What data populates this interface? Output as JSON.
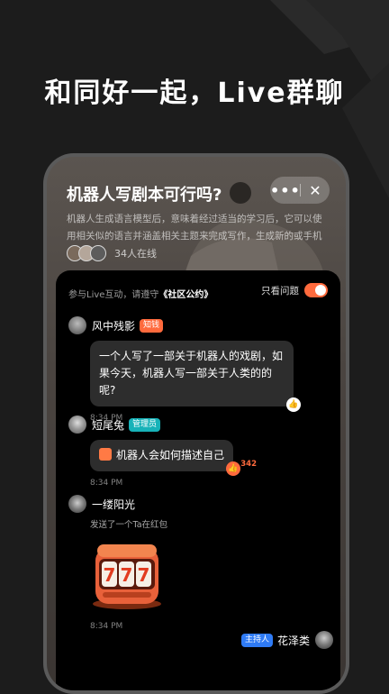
{
  "headline": "和同好一起，Live群聊",
  "room": {
    "title": "机器人写剧本可行吗?",
    "more_label": "•••",
    "close_label": "✕",
    "description": "机器人生成语言模型后，意味着经过适当的学习后，它可以使用相关似的语言并涵盖相关主题来完成写作，生成新的或手机",
    "online_count": "34人在线"
  },
  "chat": {
    "notice_prefix": "参与Live互动，请遵守",
    "notice_link": "《社区公约》",
    "filter_label": "只看问题",
    "filter_on": true,
    "messages": [
      {
        "user": "风中残影",
        "badge": "知钱",
        "badge_color": "#ff6a3d",
        "text": "一个人写了一部关于机器人的戏剧，如果今天，机器人写一部关于人类的的呢?",
        "time": "8:34 PM"
      },
      {
        "user": "短尾兔",
        "badge": "管理员",
        "badge_color": "#17b2b8",
        "text": "机器人会如何描述自己",
        "likes": "342",
        "time": "8:34 PM"
      },
      {
        "user": "一缕阳光",
        "subtitle": "发送了一个Ta在红包",
        "slot_value": "777",
        "time": "8:34 PM"
      }
    ],
    "host": {
      "badge": "主持人",
      "badge_color": "#2f7bf5",
      "user": "花泽类"
    }
  },
  "icons": {
    "like": "thumbs-up-icon",
    "gift": "gift-icon",
    "close": "close-icon",
    "more": "more-icon"
  }
}
